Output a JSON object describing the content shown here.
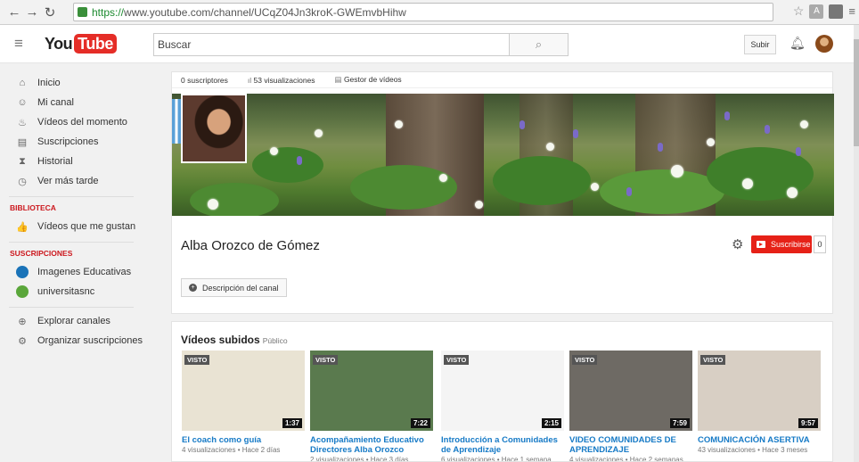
{
  "browser": {
    "url_https": "https://",
    "url_rest": "www.youtube.com/channel/UCqZ04Jn3kroK-GWEmvbHihw",
    "ext_label": "A"
  },
  "header": {
    "logo_you": "You",
    "logo_tube": "Tube",
    "search_placeholder": "Buscar",
    "upload_label": "Subir"
  },
  "sidebar": {
    "nav": [
      {
        "label": "Inicio",
        "icon": "home-icon",
        "glyph": "⌂"
      },
      {
        "label": "Mi canal",
        "icon": "user-icon",
        "glyph": "☺"
      },
      {
        "label": "Vídeos del momento",
        "icon": "flame-icon",
        "glyph": "♨"
      },
      {
        "label": "Suscripciones",
        "icon": "subscriptions-icon",
        "glyph": "▤"
      },
      {
        "label": "Historial",
        "icon": "history-icon",
        "glyph": "⧗"
      },
      {
        "label": "Ver más tarde",
        "icon": "clock-icon",
        "glyph": "◷"
      }
    ],
    "library_heading": "BIBLIOTECA",
    "library": [
      {
        "label": "Vídeos que me gustan",
        "icon": "thumbs-up-icon",
        "glyph": "👍"
      }
    ],
    "subs_heading": "SUSCRIPCIONES",
    "subs": [
      {
        "label": "Imagenes Educativas",
        "color": "#1a73b8"
      },
      {
        "label": "universitasnc",
        "color": "#5aa63a"
      }
    ],
    "extra": [
      {
        "label": "Explorar canales",
        "icon": "plus-circle-icon",
        "glyph": "⊕"
      },
      {
        "label": "Organizar suscripciones",
        "icon": "gear-icon",
        "glyph": "⚙"
      }
    ]
  },
  "channel": {
    "stats": {
      "subscribers": "0 suscriptores",
      "views": "53 visualizaciones",
      "manager": "Gestor de vídeos"
    },
    "name": "Alba Orozco de Gómez",
    "subscribe_label": "Suscribirse",
    "subscribe_count": "0",
    "description_button": "Descripción del canal"
  },
  "videos_section": {
    "title": "Vídeos subidos",
    "visibility": "Público",
    "videos": [
      {
        "badge": "VISTO",
        "duration": "1:37",
        "title": "El coach como guía",
        "meta": "4 visualizaciones • Hace 2 días",
        "thumb_bg": "#e9e3d3"
      },
      {
        "badge": "VISTO",
        "duration": "7:22",
        "title": "Acompañamiento Educativo Directores Alba Orozco",
        "meta": "2 visualizaciones • Hace 3 días",
        "thumb_bg": "#5a7a4e"
      },
      {
        "badge": "VISTO",
        "duration": "2:15",
        "title": "Introducción a Comunidades de Aprendizaje",
        "meta": "6 visualizaciones • Hace 1 semana",
        "thumb_bg": "#f4f4f4"
      },
      {
        "badge": "VISTO",
        "duration": "7:59",
        "title": "VIDEO COMUNIDADES DE APRENDIZAJE",
        "meta": "4 visualizaciones • Hace 2 semanas",
        "thumb_bg": "#6e6a64"
      },
      {
        "badge": "VISTO",
        "duration": "9:57",
        "title": "COMUNICACIÓN ASERTIVA",
        "meta": "43 visualizaciones • Hace 3 meses",
        "thumb_bg": "#d8cfc4"
      }
    ]
  }
}
